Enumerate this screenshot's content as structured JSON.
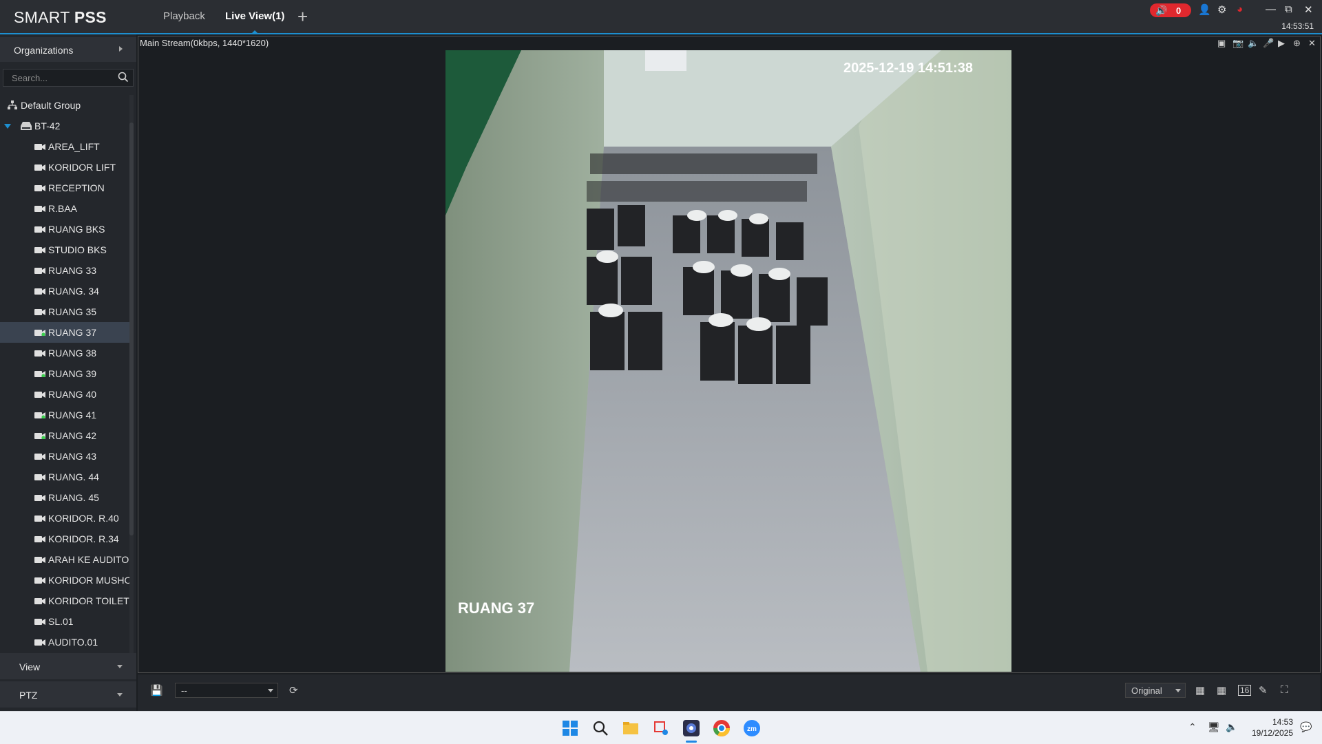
{
  "app": {
    "logo_regular": "SMART ",
    "logo_bold": "PSS",
    "tabs": [
      {
        "label": "Playback"
      },
      {
        "label": "Live View(1)"
      }
    ],
    "alarm_count": "0",
    "clock": "14:53:51"
  },
  "sidebar": {
    "organizations_label": "Organizations",
    "search_placeholder": "Search...",
    "default_group": "Default Group",
    "device": "BT-42",
    "cameras": [
      {
        "label": "AREA_LIFT",
        "online": false
      },
      {
        "label": "KORIDOR LIFT",
        "online": false
      },
      {
        "label": "RECEPTION",
        "online": false
      },
      {
        "label": "R.BAA",
        "online": false
      },
      {
        "label": "RUANG BKS",
        "online": false
      },
      {
        "label": "STUDIO BKS",
        "online": false
      },
      {
        "label": "RUANG 33",
        "online": false
      },
      {
        "label": "RUANG. 34",
        "online": false
      },
      {
        "label": "RUANG 35",
        "online": false
      },
      {
        "label": "RUANG  37",
        "online": true,
        "selected": true
      },
      {
        "label": "RUANG 38",
        "online": false
      },
      {
        "label": "RUANG 39",
        "online": true
      },
      {
        "label": "RUANG 40",
        "online": false
      },
      {
        "label": "RUANG 41",
        "online": true
      },
      {
        "label": "RUANG 42",
        "online": true
      },
      {
        "label": "RUANG 43",
        "online": false
      },
      {
        "label": "RUANG. 44",
        "online": false
      },
      {
        "label": "RUANG. 45",
        "online": false
      },
      {
        "label": "KORIDOR. R.40",
        "online": false
      },
      {
        "label": "KORIDOR. R.34",
        "online": false
      },
      {
        "label": "ARAH KE AUDITORIUM",
        "online": false
      },
      {
        "label": "KORIDOR MUSHOLA",
        "online": false
      },
      {
        "label": "KORIDOR TOILET",
        "online": false
      },
      {
        "label": "SL.01",
        "online": false
      },
      {
        "label": "AUDITO.01",
        "online": false
      }
    ],
    "view_label": "View",
    "ptz_label": "PTZ"
  },
  "video": {
    "stream_info": "Main Stream(0kbps, 1440*1620)",
    "osd_timestamp": "2025-12-19 14:51:38",
    "osd_name": "RUANG 37"
  },
  "bottom": {
    "preset_value": "--",
    "scale_value": "Original",
    "split_16": "16"
  },
  "taskbar": {
    "time": "14:53",
    "date": "19/12/2025"
  },
  "colors": {
    "accent": "#1d8fd0",
    "alarm": "#e0282e",
    "online": "#3ccf4e"
  }
}
